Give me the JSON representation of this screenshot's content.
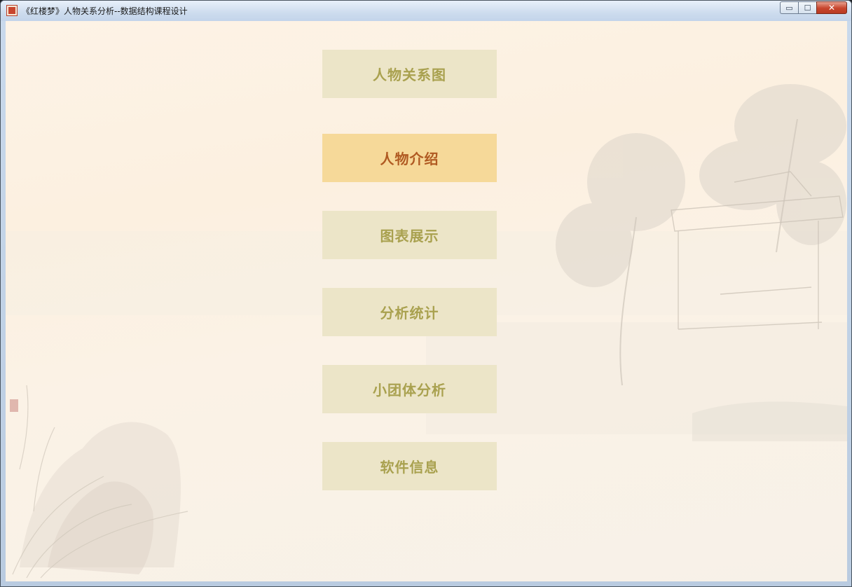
{
  "window": {
    "title": "《红楼梦》人物关系分析--数据结构课程设计",
    "controls": {
      "minimize": "▭",
      "maximize": "☐",
      "close": "✕"
    }
  },
  "menu": {
    "items": [
      {
        "label": "人物关系图",
        "active": false
      },
      {
        "label": "人物介绍",
        "active": true
      },
      {
        "label": "图表展示",
        "active": false
      },
      {
        "label": "分析统计",
        "active": false
      },
      {
        "label": "小团体分析",
        "active": false
      },
      {
        "label": "软件信息",
        "active": false
      }
    ]
  },
  "colors": {
    "button_bg": "#ece5c8",
    "button_text": "#a9a14f",
    "button_active_bg": "#f6d999",
    "button_active_text": "#b05a22"
  }
}
